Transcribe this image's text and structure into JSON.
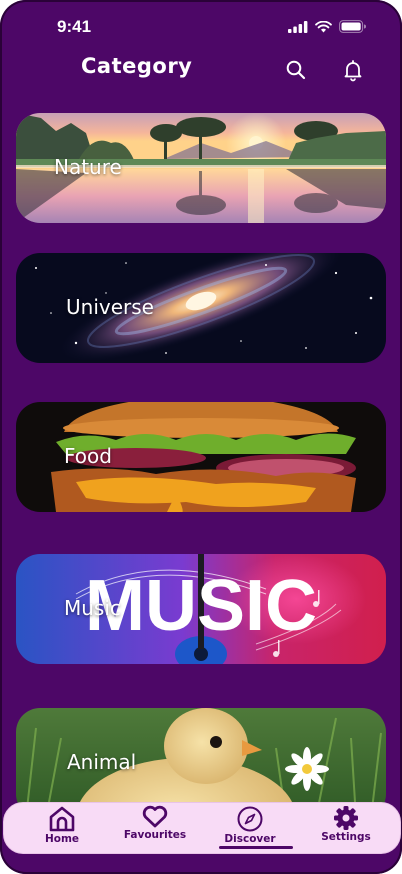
{
  "status": {
    "time": "9:41"
  },
  "header": {
    "title": "Category",
    "search_icon": "search-icon",
    "bell_icon": "bell-icon"
  },
  "categories": [
    {
      "label": "Nature"
    },
    {
      "label": "Universe"
    },
    {
      "label": "Food"
    },
    {
      "label": "Music",
      "art_text": "MUSIC"
    },
    {
      "label": "Animal"
    }
  ],
  "nav": {
    "items": [
      {
        "label": "Home",
        "icon": "home-icon"
      },
      {
        "label": "Favourites",
        "icon": "heart-icon"
      },
      {
        "label": "Discover",
        "icon": "compass-icon",
        "active": true
      },
      {
        "label": "Settings",
        "icon": "gear-icon"
      }
    ]
  },
  "colors": {
    "background": "#4d0767",
    "nav_background": "#f8dbf6",
    "accent": "#4d0767"
  }
}
